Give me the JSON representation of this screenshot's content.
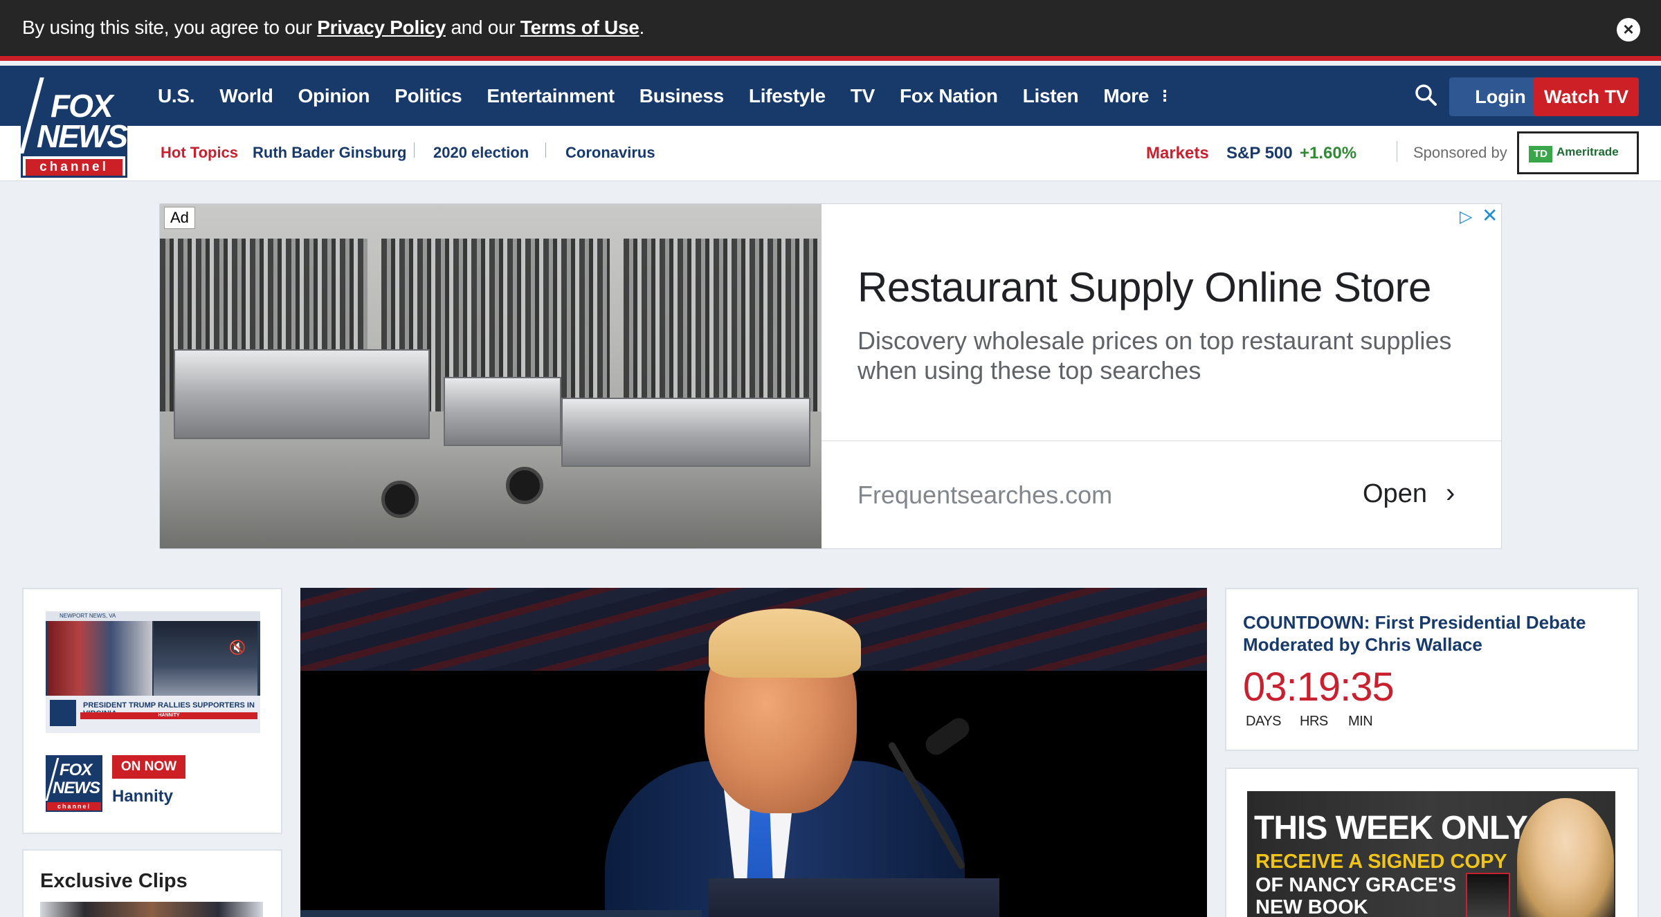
{
  "cookie": {
    "prefix": "By using this site, you agree to our ",
    "privacy": "Privacy Policy",
    "middle": " and our ",
    "terms": "Terms of Use",
    "suffix": ".",
    "close_icon": "close-icon"
  },
  "logo": {
    "fox": "FOX",
    "news": "NEWS",
    "channel": "channel"
  },
  "nav": {
    "items": [
      "U.S.",
      "World",
      "Opinion",
      "Politics",
      "Entertainment",
      "Business",
      "Lifestyle",
      "TV",
      "Fox Nation",
      "Listen",
      "More"
    ],
    "more_icon": "vertical-dots-icon",
    "login": "Login",
    "watch_tv": "Watch TV"
  },
  "subnav": {
    "hot_topics": "Hot Topics",
    "topics": [
      "Ruth Bader Ginsburg",
      "2020 election",
      "Coronavirus"
    ],
    "markets": "Markets",
    "index_name": "S&P 500",
    "index_change": "+1.60%",
    "sponsored_by": "Sponsored by",
    "sponsor_mark": "TD",
    "sponsor_name": "Ameritrade"
  },
  "ad": {
    "label": "Ad",
    "title": "Restaurant Supply Online Store",
    "description": "Discovery wholesale prices on top restaurant supplies when using these top searches",
    "url": "Frequentsearches.com",
    "cta": "Open",
    "chevron": "›",
    "info": "▷",
    "close": "✕"
  },
  "left_rail": {
    "video_top_text": "NEWPORT NEWS, VA",
    "video_banner": "PRESIDENT TRUMP RALLIES SUPPORTERS IN VIRGINIA",
    "video_banner_show": "HANNITY",
    "on_now": "ON NOW",
    "show_name": "Hannity",
    "small_logo_fox": "FOX",
    "small_logo_news": "NEWS",
    "small_logo_channel": "channel",
    "exclusive_clips": "Exclusive Clips"
  },
  "countdown": {
    "title": "COUNTDOWN: First Presidential Debate Moderated by Chris Wallace",
    "time": "03:19:35",
    "units": [
      "DAYS",
      "HRS",
      "MIN"
    ],
    "color": "#c8202f"
  },
  "promo": {
    "line1": "THIS WEEK ONLY",
    "line2": "RECEIVE A SIGNED COPY",
    "line3": "OF NANCY GRACE'S",
    "line4": "NEW BOOK"
  },
  "colors": {
    "brand_navy": "#183a6b",
    "brand_red": "#cc1f26",
    "login_blue": "#2f5791",
    "market_green": "#2f8a33"
  }
}
